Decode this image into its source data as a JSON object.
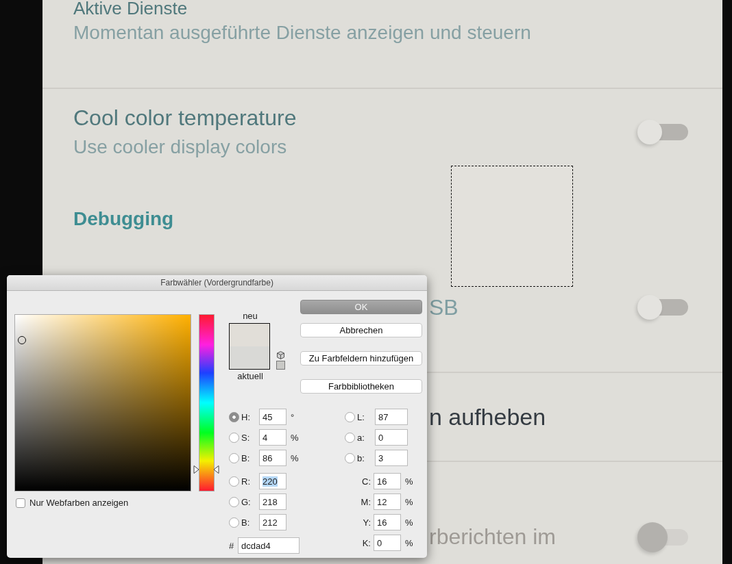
{
  "background": {
    "rows": [
      {
        "kind": "item",
        "title": "Aktive Dienste",
        "subtitle": "Momentan ausgeführte Dienste anzeigen und steuern",
        "covered": false
      },
      {
        "kind": "toggle",
        "title": "Cool color temperature",
        "subtitle": "Use cooler display colors",
        "covered": false,
        "toggle": {
          "on": false,
          "disabled": false
        }
      },
      {
        "kind": "header",
        "title": "Debugging",
        "covered": false
      },
      {
        "kind": "toggle",
        "title": "SB",
        "covered": true,
        "toggle": {
          "on": false,
          "disabled": false
        }
      },
      {
        "kind": "item",
        "title": "n aufheben",
        "covered": true
      },
      {
        "kind": "toggle",
        "title": "rberichten im",
        "covered": true,
        "toggle": {
          "on": false,
          "disabled": true
        }
      }
    ]
  },
  "dialog": {
    "title": "Farbwähler (Vordergrundfarbe)",
    "hue_slider": {
      "level": 0.125
    },
    "new_label": "neu",
    "current_label": "aktuell",
    "buttons": [
      {
        "label": "OK",
        "default": true
      },
      {
        "label": "Abbrechen",
        "default": false
      },
      {
        "label": "Zu Farbfeldern hinzufügen",
        "default": false
      },
      {
        "label": "Farbbibliotheken",
        "default": false
      }
    ],
    "left_fields": [
      {
        "kind": "radio",
        "label": "H:",
        "value": "45",
        "unit": "°",
        "selected": true,
        "highlighted": false
      },
      {
        "kind": "radio",
        "label": "S:",
        "value": "4",
        "unit": "%",
        "selected": false,
        "highlighted": false
      },
      {
        "kind": "radio",
        "label": "B:",
        "value": "86",
        "unit": "%",
        "selected": false,
        "highlighted": false
      },
      {
        "kind": "radio",
        "label": "R:",
        "value": "220",
        "selected": false,
        "highlighted": true
      },
      {
        "kind": "radio",
        "label": "G:",
        "value": "218",
        "selected": false,
        "highlighted": false
      },
      {
        "kind": "radio",
        "label": "B:",
        "value": "212",
        "selected": false,
        "highlighted": false
      },
      {
        "kind": "plain",
        "label": "#",
        "value": "dcdad4",
        "highlighted": false
      }
    ],
    "right_fields": [
      {
        "kind": "radio",
        "label": "L:",
        "value": "87",
        "selected": false,
        "highlighted": false
      },
      {
        "kind": "radio",
        "label": "a:",
        "value": "0",
        "selected": false,
        "highlighted": false
      },
      {
        "kind": "radio",
        "label": "b:",
        "value": "3",
        "selected": false,
        "highlighted": false
      },
      {
        "kind": "plain",
        "label": "C:",
        "value": "16",
        "unit": "%",
        "highlighted": false
      },
      {
        "kind": "plain",
        "label": "M:",
        "value": "12",
        "unit": "%",
        "highlighted": false
      },
      {
        "kind": "plain",
        "label": "Y:",
        "value": "16",
        "unit": "%",
        "highlighted": false
      },
      {
        "kind": "plain",
        "label": "K:",
        "value": "0",
        "unit": "%",
        "highlighted": false
      }
    ],
    "checkbox": {
      "label": "Nur Webfarben anzeigen",
      "checked": false
    }
  }
}
